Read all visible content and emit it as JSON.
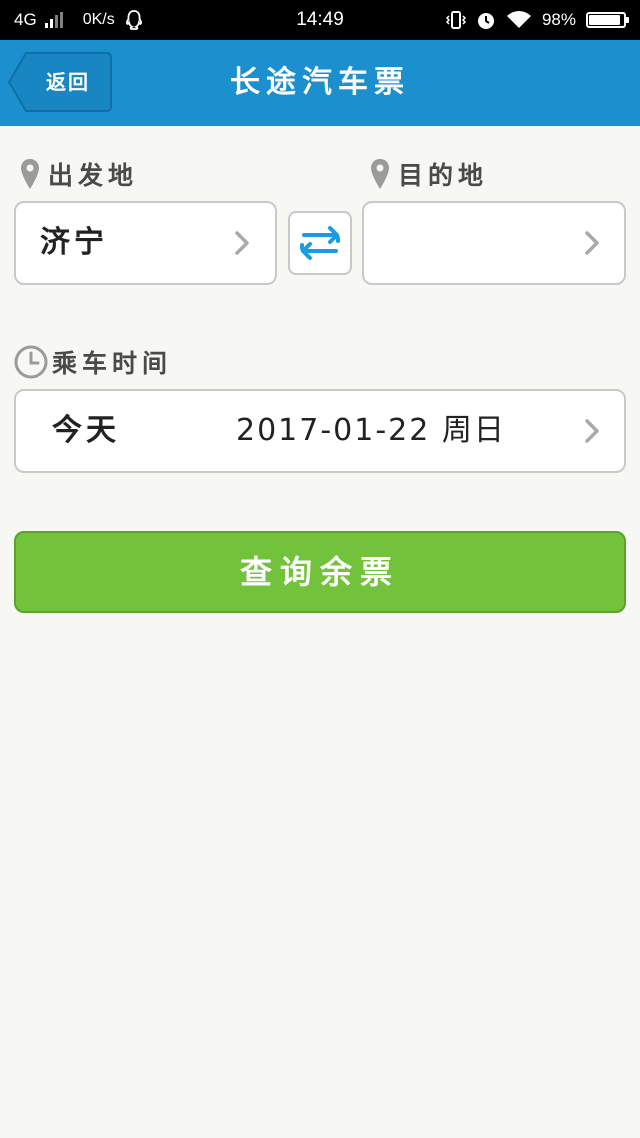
{
  "status_bar": {
    "network": "4G",
    "speed": "0K/s",
    "time": "14:49",
    "battery": "98%",
    "battery_level": 0.98
  },
  "header": {
    "back_label": "返回",
    "title": "长途汽车票"
  },
  "route": {
    "origin_label": "出发地",
    "origin_value": "济宁",
    "destination_label": "目的地",
    "destination_value": ""
  },
  "departure": {
    "label": "乘车时间",
    "relative_day": "今天",
    "date": "2017-01-22 周日"
  },
  "search_button_label": "查询余票",
  "colors": {
    "header": "#1c8fce",
    "button": "#73c23b",
    "swap_icon": "#1a9de0",
    "background": "#f7f7f3"
  },
  "icons": [
    "qq-icon",
    "vibrate-icon",
    "alarm-icon",
    "wifi-icon",
    "battery-icon",
    "pin-icon",
    "swap-icon",
    "clock-icon",
    "chevron-right-icon"
  ]
}
